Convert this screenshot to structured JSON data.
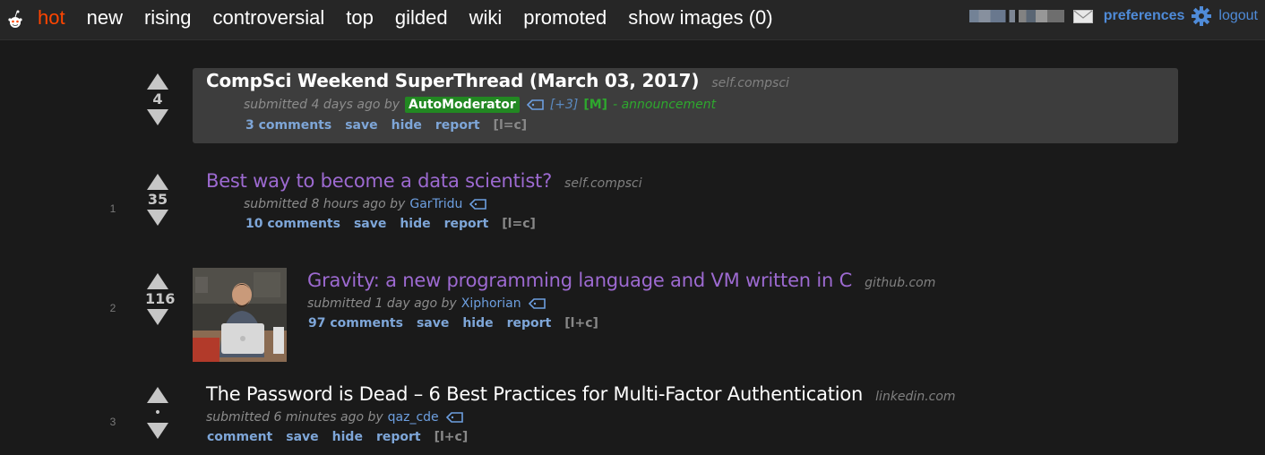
{
  "header": {
    "tabs": [
      {
        "label": "hot",
        "active": true
      },
      {
        "label": "new"
      },
      {
        "label": "rising"
      },
      {
        "label": "controversial"
      },
      {
        "label": "top"
      },
      {
        "label": "gilded"
      },
      {
        "label": "wiki"
      },
      {
        "label": "promoted"
      },
      {
        "label": "show images (0)"
      }
    ],
    "preferences": "preferences",
    "logout": "logout"
  },
  "posts": [
    {
      "rank": "",
      "score": "4",
      "title": "CompSci Weekend SuperThread (March 03, 2017)",
      "domain": "self.compsci",
      "submitted": "submitted 4 days ago by",
      "author": "AutoModerator",
      "plus": "[+3]",
      "mflag": "[M]",
      "flair": "- announcement",
      "buttons": [
        "3 comments",
        "save",
        "hide",
        "report"
      ],
      "expando": "[l=c]"
    },
    {
      "rank": "1",
      "score": "35",
      "title": "Best way to become a data scientist?",
      "domain": "self.compsci",
      "submitted": "submitted 8 hours ago by",
      "author": "GarTridu",
      "buttons": [
        "10 comments",
        "save",
        "hide",
        "report"
      ],
      "expando": "[l=c]"
    },
    {
      "rank": "2",
      "score": "116",
      "title": "Gravity: a new programming language and VM written in C",
      "domain": "github.com",
      "submitted": "submitted 1 day ago by",
      "author": "Xiphorian",
      "buttons": [
        "97 comments",
        "save",
        "hide",
        "report"
      ],
      "expando": "[l+c]"
    },
    {
      "rank": "3",
      "score": "•",
      "title": "The Password is Dead – 6 Best Practices for Multi-Factor Authentication",
      "domain": "linkedin.com",
      "submitted": "submitted 6 minutes ago by",
      "author": "qaz_cde",
      "buttons": [
        "comment",
        "save",
        "hide",
        "report"
      ],
      "expando": "[l+c]"
    }
  ],
  "icons": {
    "logo": "reddit-alien-icon",
    "mail": "mail-icon",
    "settings": "gear-icon",
    "tag": "tag-icon"
  },
  "colors": {
    "active_tab": "#ff4500",
    "visited_title": "#9d6ad1",
    "link_blue": "#6d9fe0",
    "mod_green": "#228822"
  }
}
